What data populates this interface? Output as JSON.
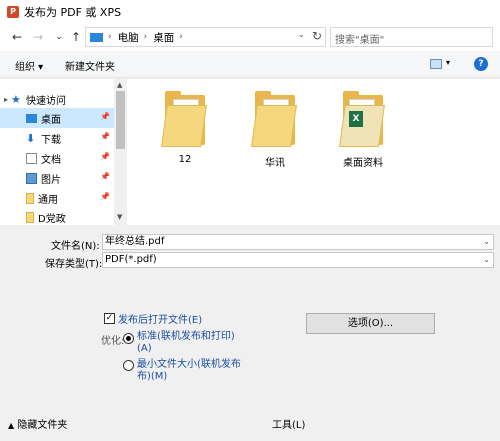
{
  "window": {
    "title": "发布为 PDF 或 XPS",
    "app_icon": "P"
  },
  "nav": {
    "back": "←",
    "forward": "→",
    "recent": "⌄",
    "up": "↑"
  },
  "address": {
    "crumbs": [
      "电脑",
      "桌面"
    ],
    "sep": "›",
    "dropdown": "⌄",
    "refresh": "↻"
  },
  "search": {
    "placeholder": "搜索\"桌面\""
  },
  "toolbar": {
    "organize": "组织 ▾",
    "new_folder": "新建文件夹",
    "view_dropdown": "▾",
    "help": "?"
  },
  "sidebar": {
    "items": [
      {
        "label": "快速访问",
        "icon": "star-icon"
      },
      {
        "label": "桌面",
        "icon": "desktop-icon",
        "pinned": true
      },
      {
        "label": "下载",
        "icon": "download-icon",
        "pinned": true
      },
      {
        "label": "文档",
        "icon": "document-icon",
        "pinned": true
      },
      {
        "label": "图片",
        "icon": "picture-icon",
        "pinned": true
      },
      {
        "label": "通用",
        "icon": "folder-icon",
        "pinned": true
      },
      {
        "label": "D党政",
        "icon": "folder-icon"
      }
    ],
    "pin_glyph": "📌",
    "expand_glyph": "▸"
  },
  "files": [
    {
      "name": "12",
      "kind": "folder"
    },
    {
      "name": "华讯",
      "kind": "folder"
    },
    {
      "name": "桌面资料",
      "kind": "folder-excel"
    }
  ],
  "form": {
    "filename_label": "文件名(N):",
    "filename_value": "年终总结.pdf",
    "filetype_label": "保存类型(T):",
    "filetype_value": "PDF(*.pdf)"
  },
  "options": {
    "open_after": "发布后打开文件(E)",
    "open_after_checked": true,
    "optimize_label": "优化:",
    "standard_line1": "标准(联机发布和打印)",
    "standard_line2": "(A)",
    "minimum_line1": "最小文件大小(联机发布",
    "minimum_line2": "布)(M)",
    "options_button": "选项(O)..."
  },
  "footer": {
    "hide_folders": "隐藏文件夹",
    "tools": "工具(L)"
  },
  "colors": {
    "selection": "#cce8ff",
    "link_blue": "#1a4fa0",
    "folder": "#e8b64a",
    "address_folder": "#2b88d8"
  }
}
